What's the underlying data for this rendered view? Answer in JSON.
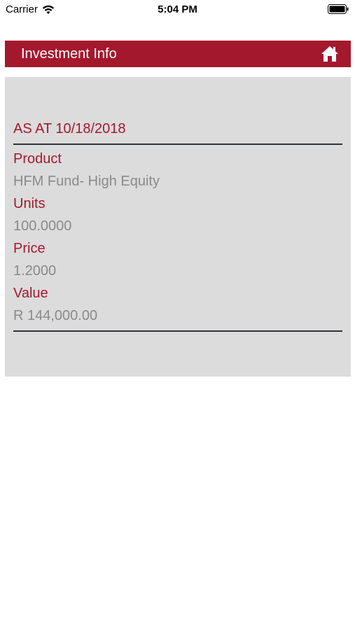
{
  "status_bar": {
    "carrier": "Carrier",
    "time": "5:04 PM"
  },
  "header": {
    "title": "Investment Info",
    "home_icon": "home-icon"
  },
  "colors": {
    "brand": "#a4182e",
    "panel": "#dcdcdc",
    "value_text": "#8a8a8a"
  },
  "investment": {
    "as_at": "AS AT 10/18/2018",
    "product_label": "Product",
    "product_value": "HFM Fund- High Equity",
    "units_label": "Units",
    "units_value": "100.0000",
    "price_label": "Price",
    "price_value": "1.2000",
    "value_label": "Value",
    "value_value": "R 144,000.00"
  }
}
